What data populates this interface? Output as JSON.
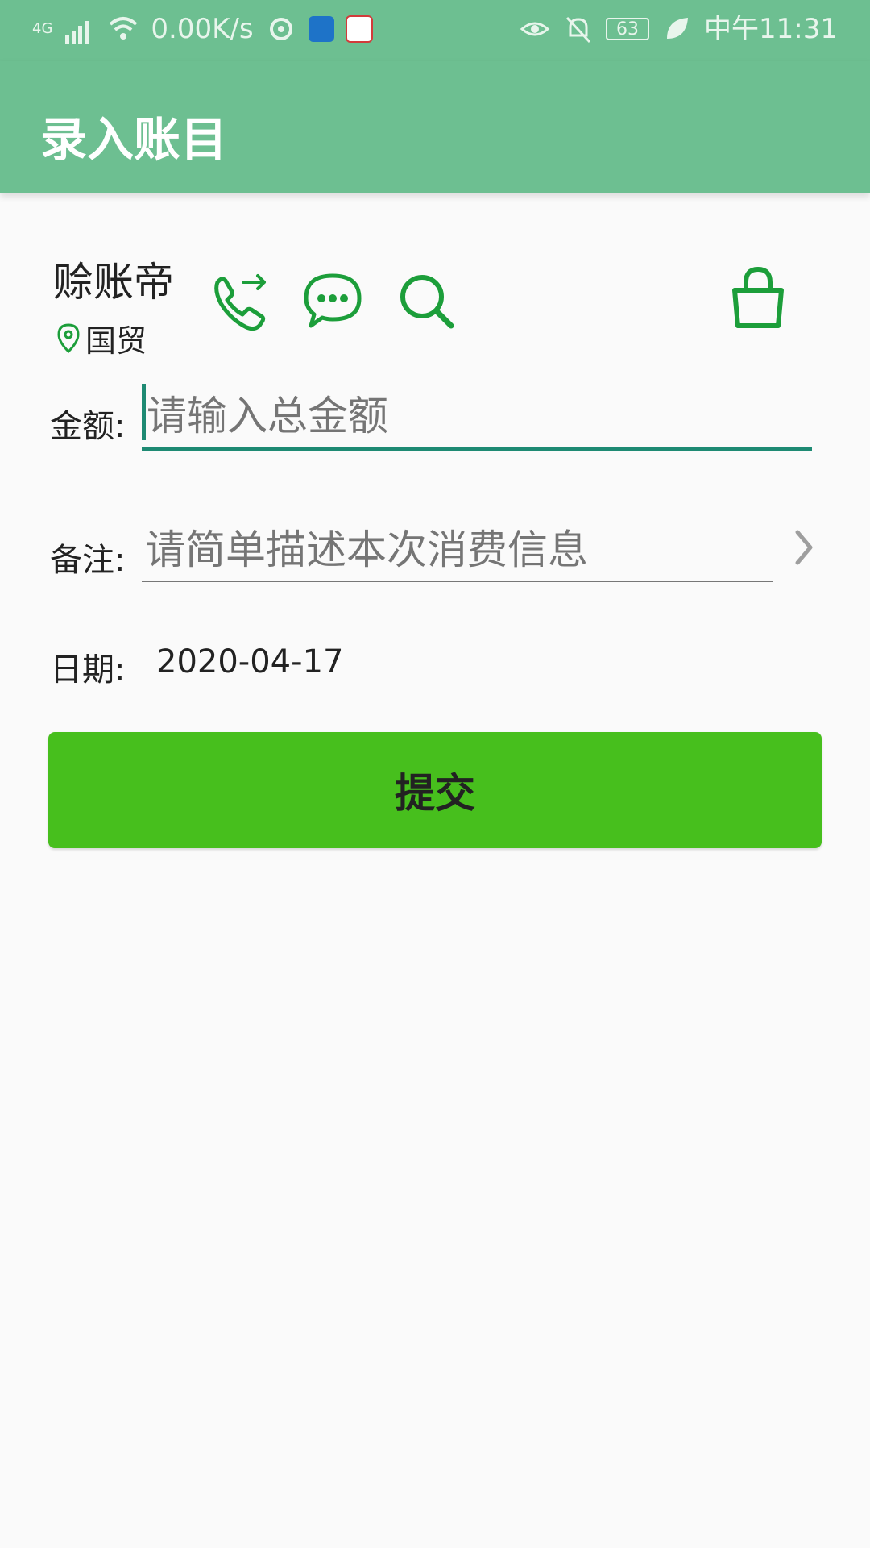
{
  "status_bar": {
    "network": "4G",
    "speed": "0.00K/s",
    "battery": "63",
    "time": "中午11:31"
  },
  "app_bar": {
    "title": "录入账目"
  },
  "shop": {
    "name": "赊账帝",
    "location": "国贸"
  },
  "form": {
    "amount_label": "金额:",
    "amount_placeholder": "请输入总金额",
    "note_label": "备注:",
    "note_placeholder": "请简单描述本次消费信息",
    "date_label": "日期:",
    "date_value": "2020-04-17"
  },
  "submit": {
    "label": "提交"
  },
  "colors": {
    "primary": "#6dbf91",
    "accent_icon": "#1c9e3a",
    "button": "#47bf1d",
    "input_focus": "#1e8a73"
  }
}
